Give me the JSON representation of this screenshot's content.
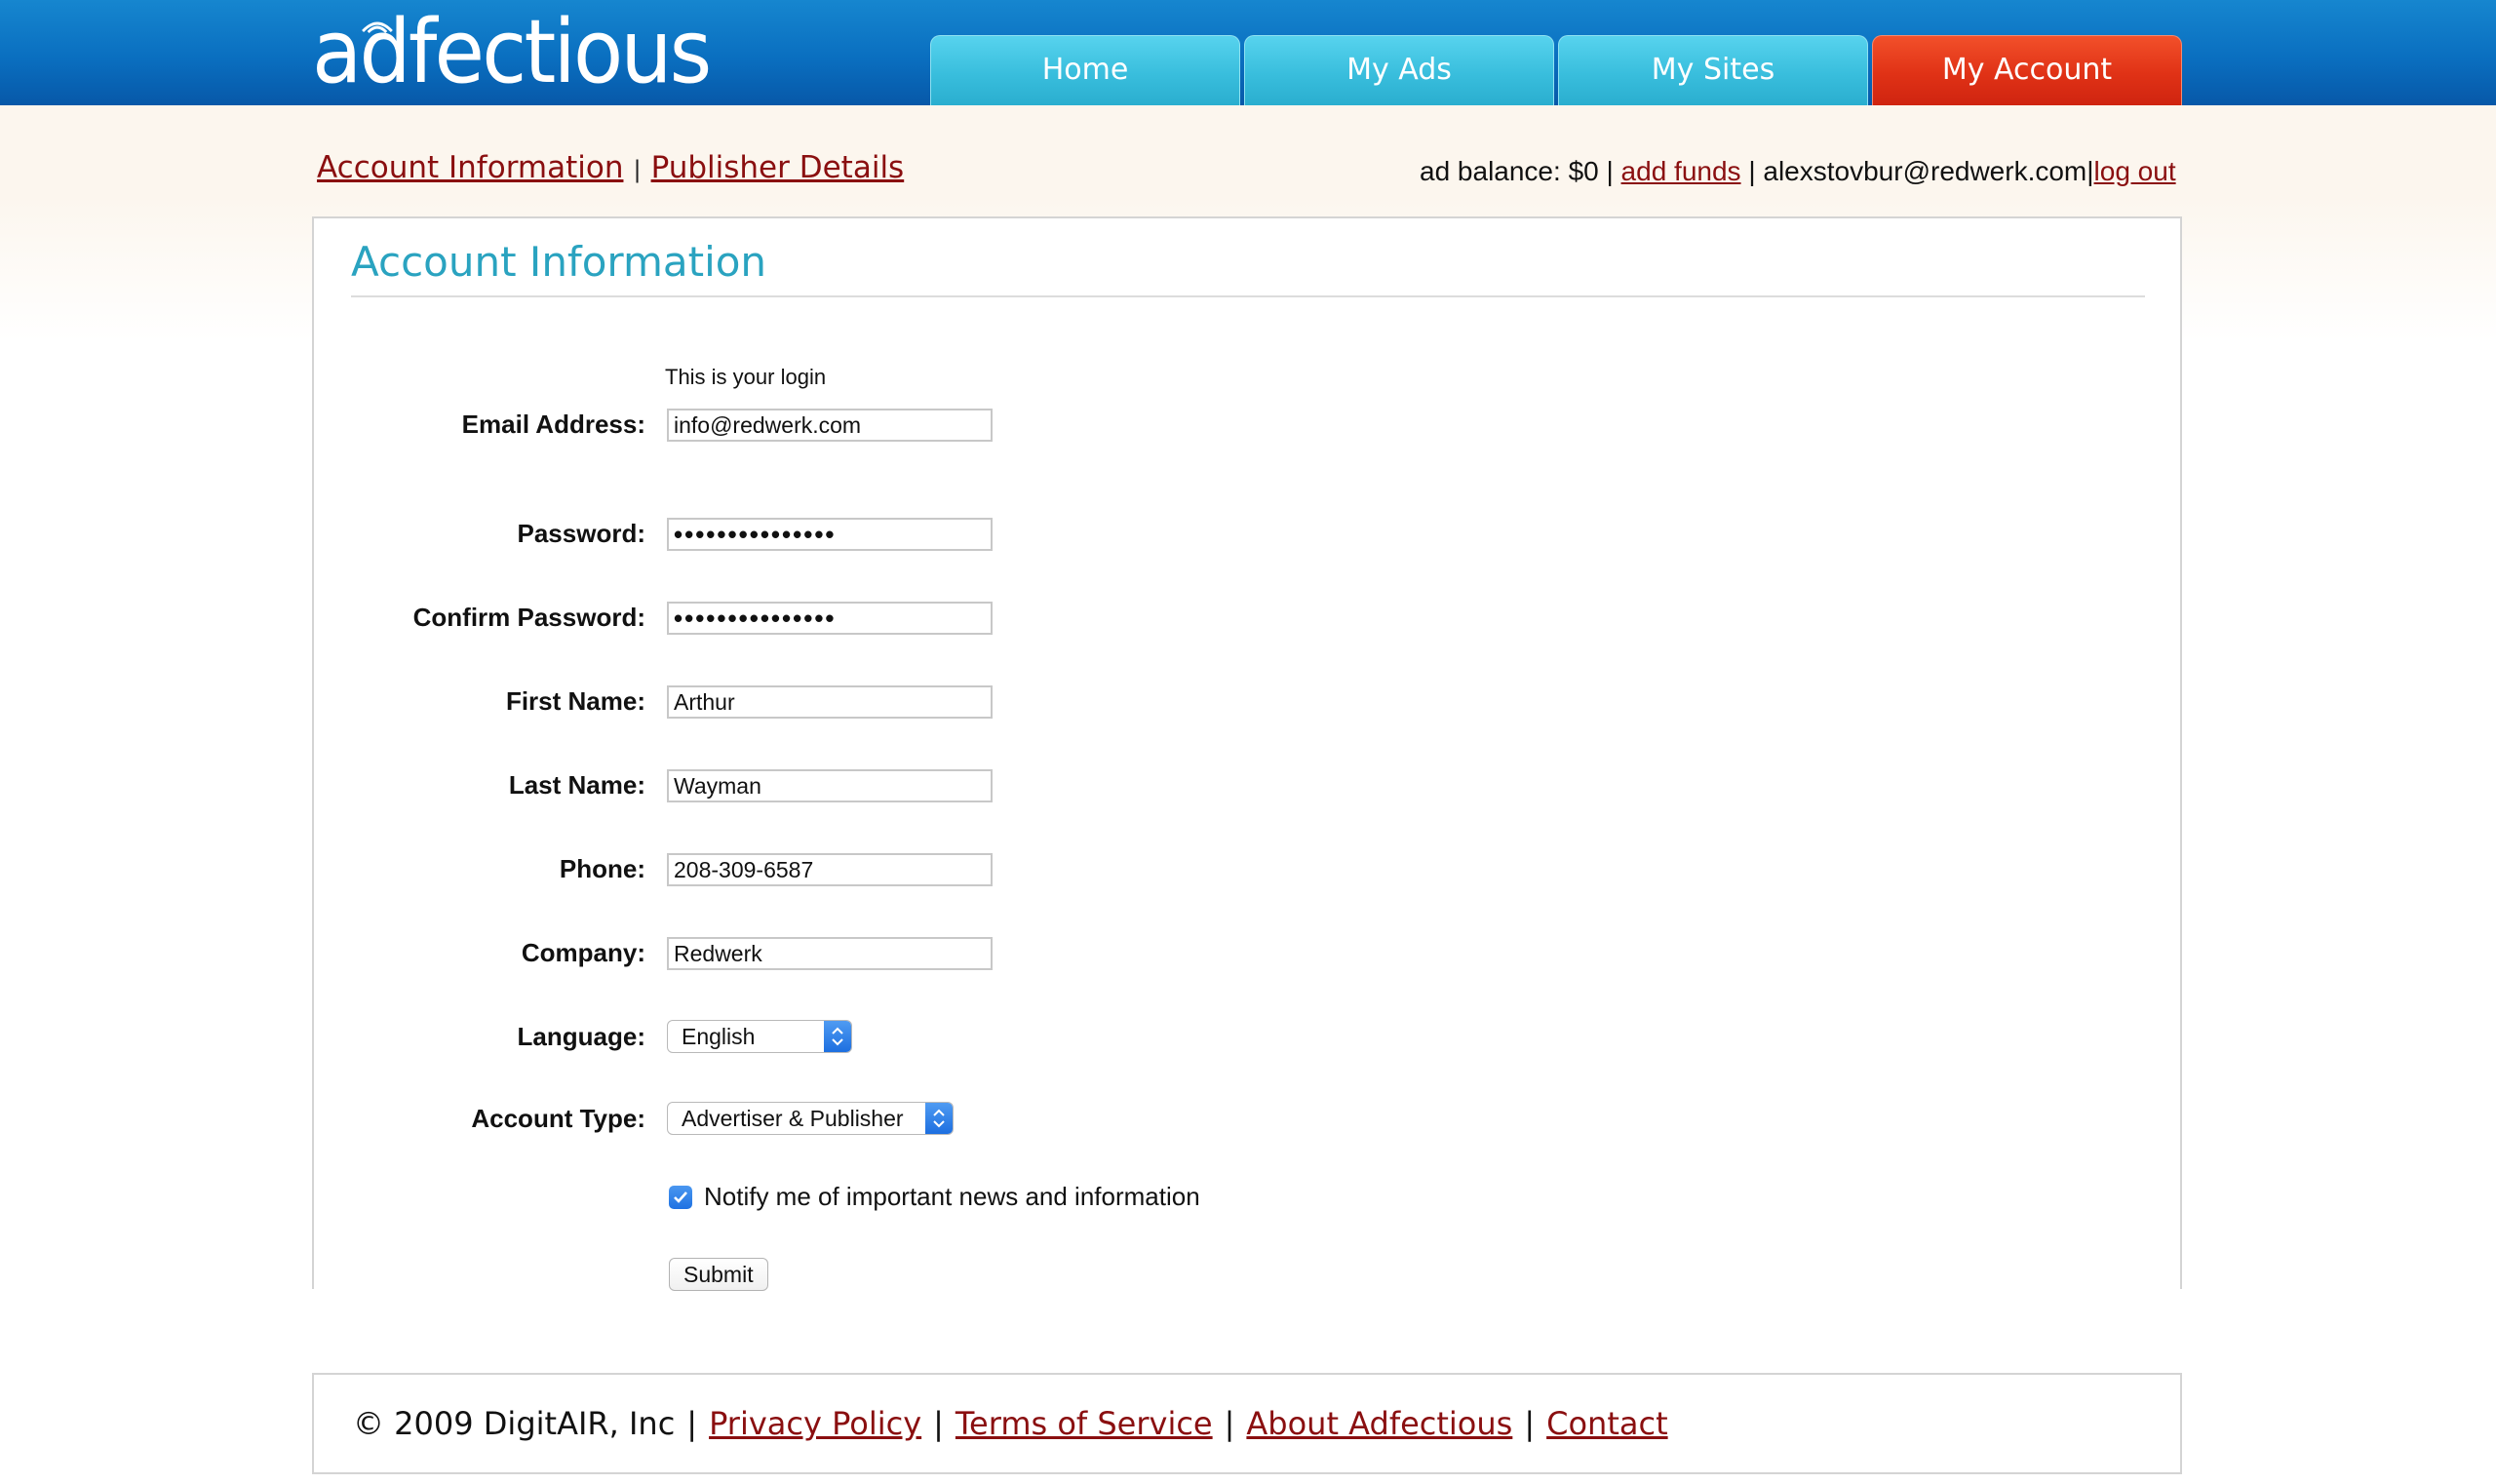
{
  "brand": {
    "logo_text": "adfectious"
  },
  "nav": {
    "tabs": [
      {
        "label": "Home"
      },
      {
        "label": "My Ads"
      },
      {
        "label": "My Sites"
      },
      {
        "label": "My Account",
        "active": true
      }
    ]
  },
  "subnav": {
    "account_info": "Account Information",
    "separator": "|",
    "publisher_details": "Publisher Details"
  },
  "account_bar": {
    "balance_text": "ad balance: $0 |",
    "add_funds": "add funds",
    "user_text": "| alexstovbur@redwerk.com|",
    "logout": "log out"
  },
  "section": {
    "title": "Account Information"
  },
  "form": {
    "login_hint": "This is your login",
    "email": {
      "label": "Email Address:",
      "value": "info@redwerk.com"
    },
    "password": {
      "label": "Password:",
      "value": "•••••••••••••••"
    },
    "confirm_password": {
      "label": "Confirm Password:",
      "value": "•••••••••••••••"
    },
    "first_name": {
      "label": "First Name:",
      "value": "Arthur"
    },
    "last_name": {
      "label": "Last Name:",
      "value": "Wayman"
    },
    "phone": {
      "label": "Phone:",
      "value": "208-309-6587"
    },
    "company": {
      "label": "Company:",
      "value": "Redwerk"
    },
    "language": {
      "label": "Language:",
      "value": "English"
    },
    "account_type": {
      "label": "Account Type:",
      "value": "Advertiser & Publisher"
    },
    "notify": {
      "label": "Notify me of important news and information",
      "checked": true
    },
    "submit_label": "Submit"
  },
  "footer": {
    "copyright": "© 2009 DigitAIR, Inc",
    "sep": "|",
    "privacy": "Privacy Policy",
    "terms": "Terms of Service",
    "about": "About Adfectious",
    "contact": "Contact"
  },
  "colors": {
    "header_blue": "#0a6fc0",
    "tab_cyan": "#39bedd",
    "tab_active_red": "#e03216",
    "title_teal": "#2aa3c0",
    "link_red": "#8a0f10"
  }
}
